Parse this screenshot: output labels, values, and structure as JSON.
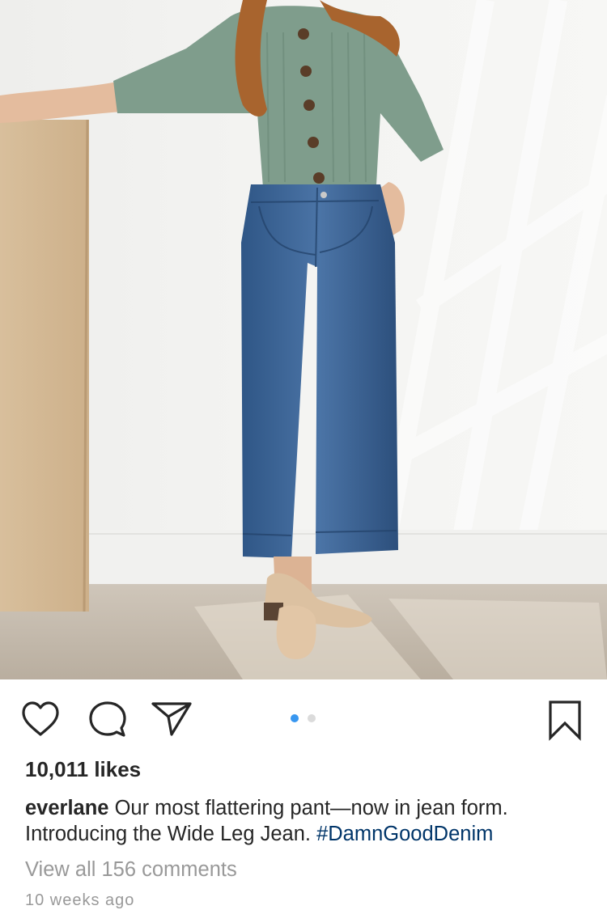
{
  "post": {
    "image_description": "product-photo",
    "likes_text": "10,011 likes",
    "caption_user": "everlane",
    "caption_line1": "Our most flattering pant—now in jean form.",
    "caption_line2": "Introducing the Wide Leg Jean.",
    "caption_hashtag": "#DamnGoodDenim",
    "view_comments": "View all 156 comments",
    "timestamp": "10 weeks ago"
  },
  "carousel": {
    "total": 2,
    "active_index": 0,
    "active_color": "#3897f0",
    "inactive_color": "#dbdbdb"
  },
  "actions": {
    "like_icon": "heart-icon",
    "comment_icon": "comment-icon",
    "share_icon": "paper-plane-icon",
    "save_icon": "bookmark-icon"
  },
  "colors": {
    "text": "#262626",
    "muted": "#999999",
    "hashtag": "#003569"
  }
}
